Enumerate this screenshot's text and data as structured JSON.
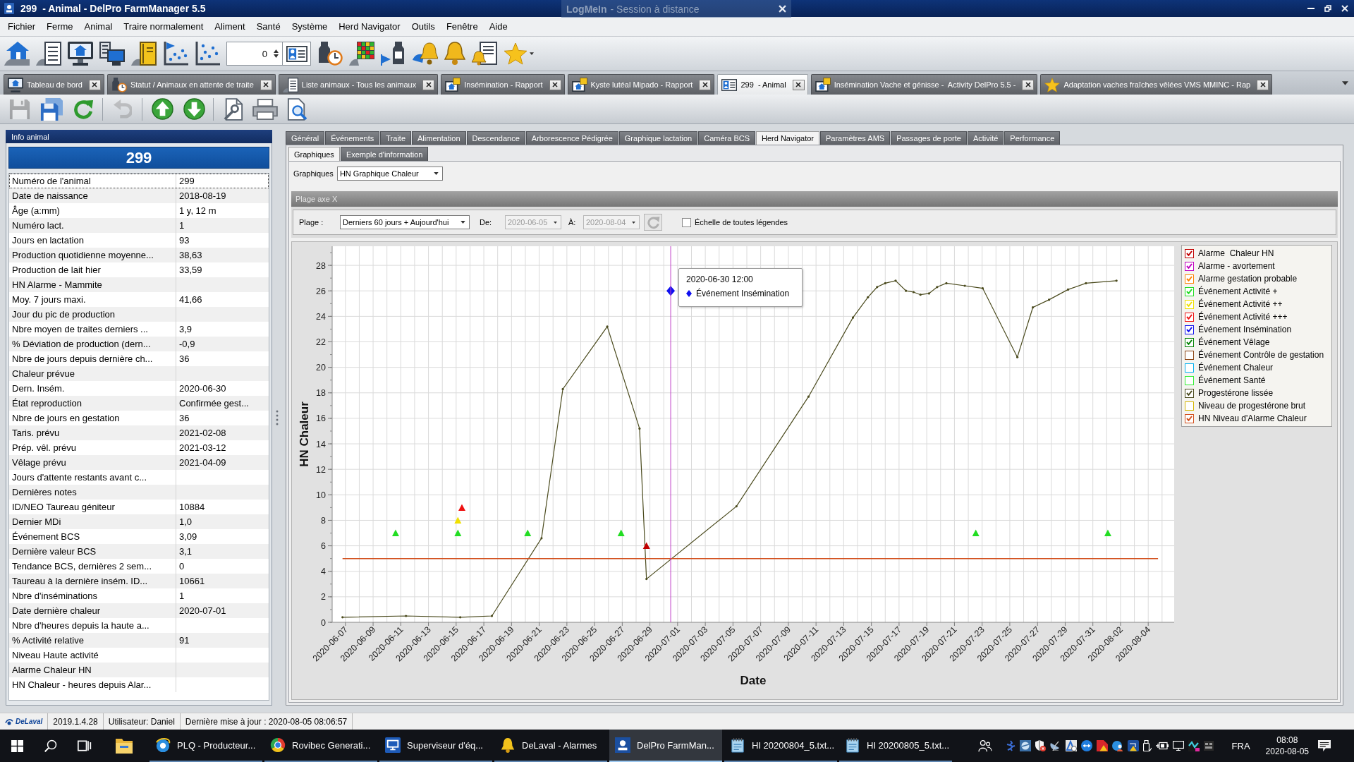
{
  "window": {
    "title": "299  - Animal - DelPro FarmManager 5.5"
  },
  "remote_banner": {
    "brand": "LogMeIn",
    "text": "- Session à distance"
  },
  "menu": [
    "Fichier",
    "Ferme",
    "Animal",
    "Traire normalement",
    "Aliment",
    "Santé",
    "Système",
    "Herd Navigator",
    "Outils",
    "Fenêtre",
    "Aide"
  ],
  "toolbar": {
    "spin_value": "0"
  },
  "document_tabs": [
    {
      "label": "Tableau de bord",
      "selected": false
    },
    {
      "label": "Statut / Animaux en attente de traite",
      "selected": false
    },
    {
      "label": "Liste animaux - Tous les animaux",
      "selected": false
    },
    {
      "label": "Insémination - Rapport",
      "selected": false
    },
    {
      "label": "Kyste lutéal Mipado - Rapport",
      "selected": false
    },
    {
      "label": "299  - Animal",
      "selected": true
    },
    {
      "label": "Insémination Vache et génisse -  Activity DelPro 5.5 -",
      "selected": false
    },
    {
      "label": "Adaptation vaches fraîches vêlées VMS MMINC - Rap",
      "selected": false
    }
  ],
  "action_buttons": [
    {
      "disabled": true
    },
    {
      "disabled": false
    },
    {
      "disabled": false
    },
    {
      "disabled": true
    },
    {
      "disabled": false
    },
    {
      "disabled": false
    },
    {
      "disabled": false
    },
    {
      "disabled": false
    },
    {
      "disabled": false
    }
  ],
  "animal_panel": {
    "title": "Info animal",
    "number": "299",
    "rows": [
      {
        "label": "Numéro de l'animal",
        "value": "299",
        "selected": true
      },
      {
        "label": "Date de naissance",
        "value": "2018-08-19",
        "selected": false
      },
      {
        "label": "Âge (a:mm)",
        "value": "1 y, 12 m",
        "selected": false
      },
      {
        "label": "Numéro lact.",
        "value": "1",
        "selected": false
      },
      {
        "label": "Jours en lactation",
        "value": "93",
        "selected": false
      },
      {
        "label": "Production quotidienne moyenne...",
        "value": "38,63",
        "selected": false
      },
      {
        "label": "Production de lait hier",
        "value": "33,59",
        "selected": false
      },
      {
        "label": "HN Alarme - Mammite",
        "selected": false
      },
      {
        "label": "Moy. 7 jours maxi.",
        "value": "41,66",
        "selected": false
      },
      {
        "label": "Jour du pic de production",
        "selected": false
      },
      {
        "label": "Nbre moyen de traites derniers ...",
        "value": "3,9",
        "selected": false
      },
      {
        "label": "% Déviation de production (dern...",
        "value": "-0,9",
        "selected": false
      },
      {
        "label": "Nbre de jours depuis dernière ch...",
        "value": "36",
        "selected": false
      },
      {
        "label": "Chaleur prévue",
        "selected": false
      },
      {
        "label": "Dern. Insém.",
        "value": "2020-06-30",
        "selected": false
      },
      {
        "label": "État reproduction",
        "value": "Confirmée gest...",
        "selected": false
      },
      {
        "label": "Nbre de jours en gestation",
        "value": "36",
        "selected": false
      },
      {
        "label": "Taris. prévu",
        "value": "2021-02-08",
        "selected": false
      },
      {
        "label": "Prép. vêl. prévu",
        "value": "2021-03-12",
        "selected": false
      },
      {
        "label": "Vêlage prévu",
        "value": "2021-04-09",
        "selected": false
      },
      {
        "label": "Jours d'attente restants avant c...",
        "selected": false
      },
      {
        "label": "Dernières notes",
        "selected": false
      },
      {
        "label": "ID/NEO Taureau géniteur",
        "value": "10884",
        "selected": false
      },
      {
        "label": "Dernier MDi",
        "value": "1,0",
        "selected": false
      },
      {
        "label": "Événement BCS",
        "value": "3,09",
        "selected": false
      },
      {
        "label": "Dernière valeur BCS",
        "value": "3,1",
        "selected": false
      },
      {
        "label": "Tendance BCS, dernières 2 sem...",
        "value": "0",
        "selected": false
      },
      {
        "label": "Taureau à la dernière insém. ID...",
        "value": "10661",
        "selected": false
      },
      {
        "label": "Nbre d'inséminations",
        "value": "1",
        "selected": false
      },
      {
        "label": "Date dernière chaleur",
        "value": "2020-07-01",
        "selected": false
      },
      {
        "label": "Nbre d'heures depuis la haute a...",
        "selected": false
      },
      {
        "label": "% Activité relative",
        "value": "91",
        "selected": false
      },
      {
        "label": "Niveau Haute activité",
        "selected": false
      },
      {
        "label": "Alarme Chaleur HN",
        "selected": false
      },
      {
        "label": "HN Chaleur - heures depuis Alar...",
        "selected": false
      }
    ]
  },
  "detail_tabs": [
    {
      "label": "Général",
      "selected": false
    },
    {
      "label": "Événements",
      "selected": false
    },
    {
      "label": "Traite",
      "selected": false
    },
    {
      "label": "Alimentation",
      "selected": false
    },
    {
      "label": "Descendance",
      "selected": false
    },
    {
      "label": "Arborescence Pédigrée",
      "selected": false
    },
    {
      "label": "Graphique lactation",
      "selected": false
    },
    {
      "label": "Caméra BCS",
      "selected": false
    },
    {
      "label": "Herd Navigator",
      "selected": true
    },
    {
      "label": "Paramètres AMS",
      "selected": false
    },
    {
      "label": "Passages de porte",
      "selected": false
    },
    {
      "label": "Activité",
      "selected": false
    },
    {
      "label": "Performance",
      "selected": false
    }
  ],
  "sub_tabs": [
    {
      "label": "Graphiques",
      "selected": true
    },
    {
      "label": "Exemple d'information",
      "selected": false
    }
  ],
  "graph_selector": {
    "label": "Graphiques",
    "value": "HN Graphique Chaleur"
  },
  "range_panel": {
    "title": "Plage axe X",
    "range_label": "Plage :",
    "range_value": "Derniers 60 jours + Aujourd'hui",
    "from_label": "De:",
    "from_value": "2020-06-05",
    "from_disabled": true,
    "to_label": "À:",
    "to_value": "2020-08-04",
    "to_disabled": true,
    "refresh_disabled": true,
    "scale_all_label": "Échelle de toutes légendes",
    "scale_all_checked": false
  },
  "chart": {
    "chart_data": {
      "type": "line",
      "xlabel": "Date",
      "ylabel": "HN Chaleur",
      "xlim": [
        "2020-06-06 01:00",
        "2020-08-05 21:00"
      ],
      "ylim": [
        0,
        29.5
      ],
      "yticks": [
        0,
        2,
        4,
        6,
        8,
        10,
        12,
        14,
        16,
        18,
        20,
        22,
        24,
        26,
        28
      ],
      "xticks": [
        "2020-06-07",
        "2020-06-09",
        "2020-06-11",
        "2020-06-13",
        "2020-06-15",
        "2020-06-17",
        "2020-06-19",
        "2020-06-21",
        "2020-06-23",
        "2020-06-25",
        "2020-06-27",
        "2020-06-29",
        "2020-07-01",
        "2020-07-03",
        "2020-07-05",
        "2020-07-07",
        "2020-07-09",
        "2020-07-11",
        "2020-07-13",
        "2020-07-15",
        "2020-07-17",
        "2020-07-19",
        "2020-07-21",
        "2020-07-23",
        "2020-07-25",
        "2020-07-27",
        "2020-07-29",
        "2020-07-31",
        "2020-08-02",
        "2020-08-04"
      ],
      "grid": true,
      "legend": true,
      "ref_lines": [
        {
          "axis": "x",
          "value": "2020-06-30 12:00",
          "color": "#c040c8"
        }
      ],
      "series": [
        {
          "name": "Alarme  Chaleur HN",
          "color": "#c00000",
          "type": "scatter",
          "marker": "triangle",
          "x": [
            "2020-06-28 18:00"
          ],
          "values": [
            6
          ]
        },
        {
          "name": "Alarme - avortement",
          "color": "#c000c0"
        },
        {
          "name": "Alarme gestation probable",
          "color": "#ff8000"
        },
        {
          "name": "Événement Activité +",
          "color": "#22dd22",
          "type": "scatter",
          "marker": "triangle",
          "x": [
            "2020-06-10 15:00",
            "2020-06-15 03:00",
            "2020-06-20 04:00",
            "2020-06-26 22:00",
            "2020-07-22 13:00",
            "2020-08-01 02:00"
          ],
          "values": [
            7,
            7,
            7,
            7,
            7,
            7
          ]
        },
        {
          "name": "Événement Activité ++",
          "color": "#f0e000",
          "type": "scatter",
          "marker": "triangle",
          "x": [
            "2020-06-15 03:00"
          ],
          "values": [
            8
          ]
        },
        {
          "name": "Événement Activité +++",
          "color": "#ee1111",
          "type": "scatter",
          "marker": "triangle",
          "x": [
            "2020-06-15 10:00"
          ],
          "values": [
            9
          ]
        },
        {
          "name": "Événement Insémination",
          "color": "#1010f0",
          "type": "scatter",
          "marker": "diamond",
          "x": [
            "2020-06-30 12:00"
          ],
          "values": [
            26
          ]
        },
        {
          "name": "Événement Vêlage",
          "color": "#008000"
        },
        {
          "name": "Événement Contrôle de gestation",
          "color": "#8b4513"
        },
        {
          "name": "Événement Chaleur",
          "color": "#00b0f0"
        },
        {
          "name": "Événement Santé",
          "color": "#33ee33"
        },
        {
          "name": "Progestérone lissée",
          "color": "#4b4b1e",
          "type": "line",
          "x": [
            "2020-06-06 19:00",
            "2020-06-11 09:00",
            "2020-06-15 07:00",
            "2020-06-17 14:00",
            "2020-06-21 04:00",
            "2020-06-22 17:00",
            "2020-06-25 22:00",
            "2020-06-28 06:00",
            "2020-06-28 18:00",
            "2020-07-05 06:00",
            "2020-07-10 11:00",
            "2020-07-13 16:00",
            "2020-07-14 18:00",
            "2020-07-15 10:00",
            "2020-07-16 00:00",
            "2020-07-16 18:00",
            "2020-07-17 12:00",
            "2020-07-18 01:00",
            "2020-07-18 13:00",
            "2020-07-19 04:00",
            "2020-07-19 18:00",
            "2020-07-20 10:00",
            "2020-07-21 18:00",
            "2020-07-23 01:00",
            "2020-07-25 13:00",
            "2020-07-26 16:00",
            "2020-07-27 20:00",
            "2020-07-29 05:00",
            "2020-07-30 12:00",
            "2020-08-01 17:00"
          ],
          "values": [
            0.4,
            0.5,
            0.4,
            0.5,
            6.6,
            18.3,
            23.2,
            15.2,
            3.4,
            9.1,
            17.7,
            23.9,
            25.5,
            26.3,
            26.6,
            26.8,
            26.0,
            25.9,
            25.7,
            25.8,
            26.3,
            26.6,
            26.4,
            26.2,
            20.8,
            24.7,
            25.3,
            26.1,
            26.6,
            26.8
          ]
        },
        {
          "name": "Niveau de progestérone brut",
          "color": "#d4b400"
        },
        {
          "name": "HN Niveau d'Alarme Chaleur",
          "color": "#d2501e",
          "type": "line",
          "x": [
            "2020-06-06 19:00",
            "2020-08-04 17:00"
          ],
          "values": [
            5,
            5
          ]
        }
      ]
    },
    "legend_checks": [
      {
        "checked": true
      },
      {
        "checked": true
      },
      {
        "checked": true
      },
      {
        "checked": true
      },
      {
        "checked": true
      },
      {
        "checked": true
      },
      {
        "checked": true
      },
      {
        "checked": true
      },
      {
        "checked": false
      },
      {
        "checked": false
      },
      {
        "checked": false
      },
      {
        "checked": true
      },
      {
        "checked": false
      },
      {
        "checked": true
      }
    ],
    "tooltip": {
      "title": "2020-06-30 12:00",
      "label": "Événement Insémination",
      "color": "#1010f0"
    }
  },
  "status_bar": {
    "brand": "DeLaval",
    "version": "2019.1.4.28",
    "user": "Utilisateur: Daniel",
    "last_update": "Dernière mise à jour : 2020-08-05 08:06:57"
  },
  "taskbar": {
    "apps": [
      {
        "label": "PLQ - Producteur...",
        "selected": false
      },
      {
        "label": "Rovibec Generati...",
        "selected": false
      },
      {
        "label": "Superviseur d'éq...",
        "selected": false
      },
      {
        "label": "DeLaval - Alarmes",
        "selected": false
      },
      {
        "label": "DelPro FarmMan...",
        "selected": true
      },
      {
        "label": "HI 20200804_5.txt...",
        "selected": false
      },
      {
        "label": "HI 20200805_5.txt...",
        "selected": false
      }
    ],
    "language": "FRA",
    "time": "08:08",
    "date": "2020-08-05"
  }
}
